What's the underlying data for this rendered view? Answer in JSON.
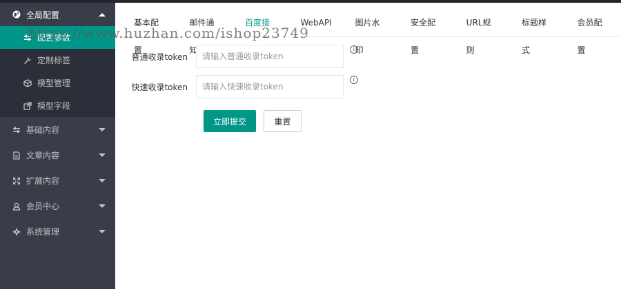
{
  "sidebar": {
    "open_group": {
      "label": "全局配置",
      "icon": "globe-icon",
      "items": [
        {
          "label": "配置参数",
          "icon": "sliders-icon",
          "active": true
        },
        {
          "label": "定制标签",
          "icon": "wrench-icon",
          "active": false
        },
        {
          "label": "模型管理",
          "icon": "cube-icon",
          "active": false
        },
        {
          "label": "模型字段",
          "icon": "external-link-icon",
          "active": false
        }
      ]
    },
    "groups": [
      {
        "label": "基础内容",
        "icon": "sliders-icon"
      },
      {
        "label": "文章内容",
        "icon": "file-icon"
      },
      {
        "label": "扩展内容",
        "icon": "expand-icon"
      },
      {
        "label": "会员中心",
        "icon": "user-icon"
      },
      {
        "label": "系统管理",
        "icon": "gear-icon"
      }
    ]
  },
  "tabs": [
    {
      "label": "基本配置",
      "active": false
    },
    {
      "label": "邮件通知",
      "active": false
    },
    {
      "label": "百度接口",
      "active": true
    },
    {
      "label": "WebAPI",
      "active": false
    },
    {
      "label": "图片水印",
      "active": false
    },
    {
      "label": "安全配置",
      "active": false
    },
    {
      "label": "URL规则",
      "active": false
    },
    {
      "label": "标题样式",
      "active": false
    },
    {
      "label": "会员配置",
      "active": false
    }
  ],
  "form": {
    "normal_token": {
      "label": "普通收录token",
      "placeholder": "请输入普通收录token",
      "value": ""
    },
    "fast_token": {
      "label": "快速收录token",
      "placeholder": "请输入快速收录token",
      "value": ""
    },
    "submit_label": "立即提交",
    "reset_label": "重置",
    "info_glyph": "i"
  },
  "watermark": "https://www.huzhan.com/ishop23749",
  "colors": {
    "accent": "#009688",
    "sidebar_bg": "#393d49",
    "sidebar_sub_bg": "#2b2f3a"
  }
}
